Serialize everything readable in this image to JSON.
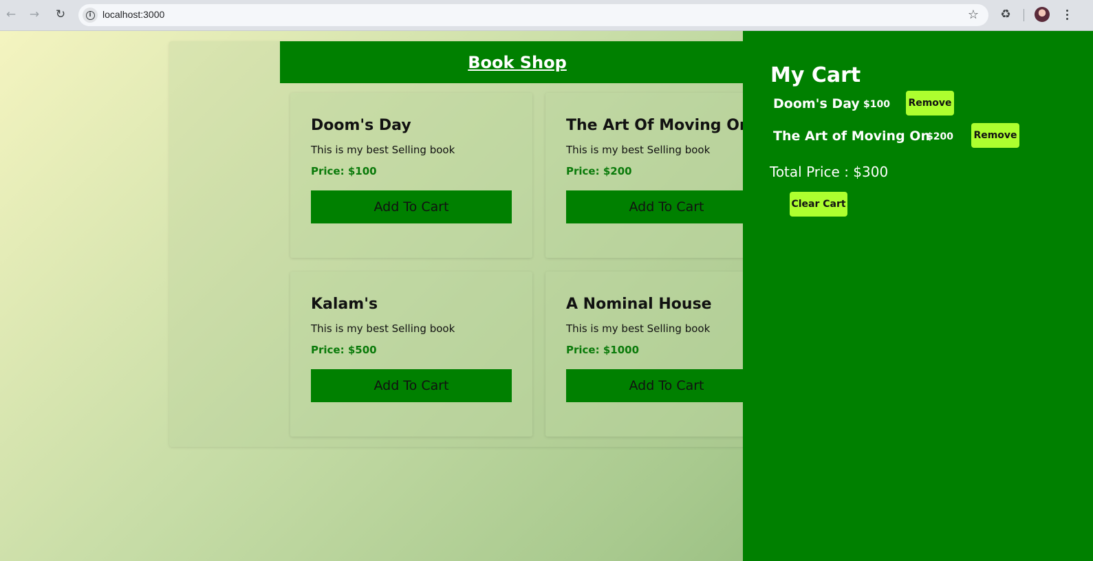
{
  "browser": {
    "url": "localhost:3000",
    "icons": [
      "back-icon",
      "forward-icon",
      "reload-icon",
      "info-icon",
      "star-icon",
      "extensions-icon",
      "profile-avatar",
      "menu-icon"
    ]
  },
  "shop": {
    "title": "Book Shop",
    "books": [
      {
        "title": "Doom's Day",
        "description": "This is my best Selling book",
        "price": "Price: $100",
        "button": "Add To Cart"
      },
      {
        "title": "The Art Of Moving On",
        "description": "This is my best Selling book",
        "price": "Price: $200",
        "button": "Add To Cart"
      },
      {
        "title": "Kalam's",
        "description": "This is my best Selling book",
        "price": "Price: $500",
        "button": "Add To Cart"
      },
      {
        "title": "A Nominal House",
        "description": "This is my best Selling book",
        "price": "Price: $1000",
        "button": "Add To Cart"
      }
    ]
  },
  "cart": {
    "title": "My Cart",
    "items": [
      {
        "name": "Doom's Day",
        "price": "$100",
        "remove_label": "Remove"
      },
      {
        "name": "The Art of Moving On",
        "price": "$200",
        "remove_label": "Remove"
      }
    ],
    "total": "Total Price : $300",
    "clear_label": "Clear Cart"
  },
  "colors": {
    "primary_green": "#008000",
    "accent_lime": "#adff2f",
    "price_green": "#0a7a0a"
  }
}
